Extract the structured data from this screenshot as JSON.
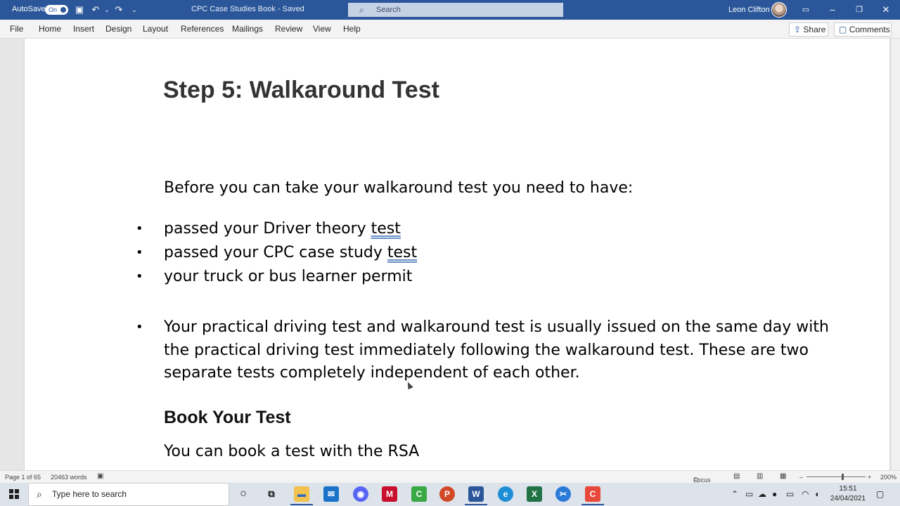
{
  "titlebar": {
    "autosave_label": "AutoSave",
    "autosave_state": "On",
    "document_title": "CPC Case Studies Book  -  Saved",
    "search_placeholder": "Search",
    "user_name": "Leon Clifton",
    "accent_color": "#2b579a"
  },
  "ribbon": {
    "tabs": [
      "File",
      "Home",
      "Insert",
      "Design",
      "Layout",
      "References",
      "Mailings",
      "Review",
      "View",
      "Help"
    ],
    "share_label": "Share",
    "comments_label": "Comments"
  },
  "document": {
    "heading": "Step 5: Walkaround Test",
    "intro": "Before you can take your walkaround test you need to have:",
    "bullets": [
      {
        "text": "passed your Driver theory ",
        "flagged": "test"
      },
      {
        "text": "passed your CPC case study ",
        "flagged": "test"
      },
      {
        "text": "your truck or bus learner permit",
        "flagged": ""
      }
    ],
    "note_paragraph": "Your practical driving test and walkaround test is usually issued on the same day with the practical driving test immediately following the walkaround test. These are two separate tests completely independent of each other.",
    "subheading": "Book Your Test",
    "book_text": "You can book a test with the RSA",
    "bullet_glyph": "•"
  },
  "statusbar": {
    "page_info": "Page 1 of 65",
    "word_count": "20463 words",
    "focus_label": "Focus",
    "zoom_level": "200%"
  },
  "taskbar": {
    "search_placeholder": "Type here to search",
    "time": "15:51",
    "date": "24/04/2021",
    "apps": [
      "cortana-icon",
      "task-view-icon",
      "file-explorer-icon",
      "mail-icon",
      "discord-icon",
      "mcafee-icon",
      "camtasia-icon",
      "powerpoint-icon",
      "word-icon",
      "edge-icon",
      "excel-icon",
      "snip-sketch-icon",
      "camtasia-recorder-icon"
    ]
  }
}
